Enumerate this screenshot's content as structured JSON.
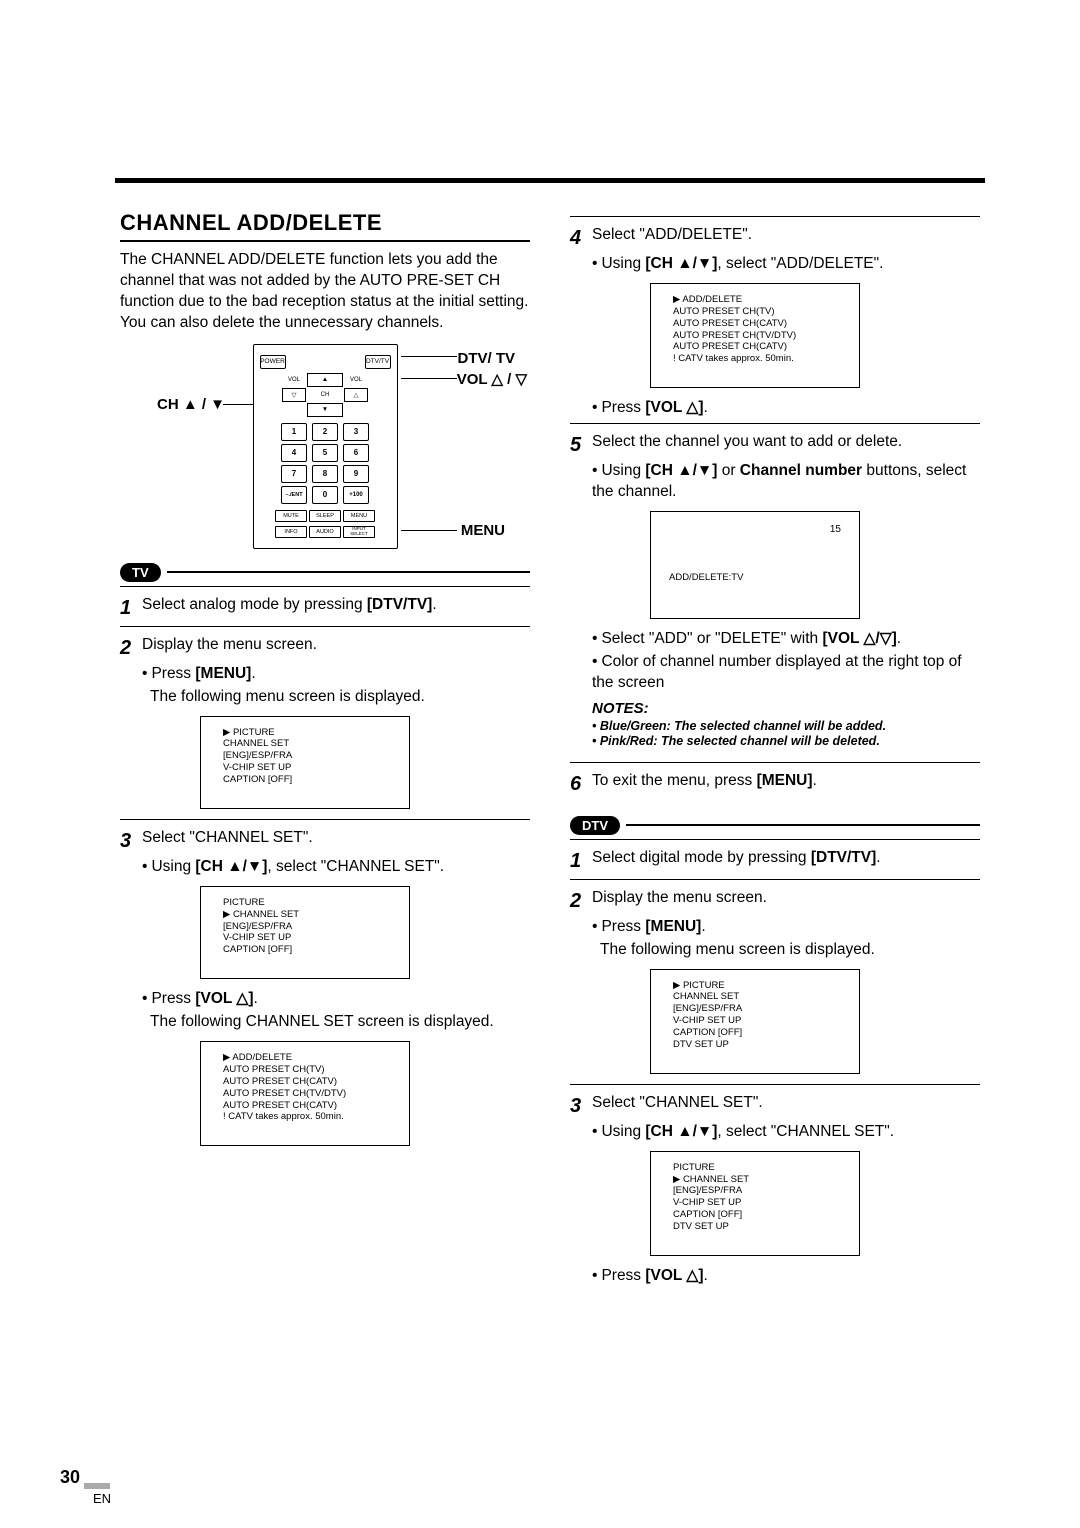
{
  "title": "CHANNEL ADD/DELETE",
  "intro": "The CHANNEL ADD/DELETE function lets you add the channel that was not added by the AUTO PRE-SET CH function due to the bad reception status at the initial setting. You can also delete the unnecessary channels.",
  "callouts": {
    "dtvtv": "DTV/ TV",
    "vol": "VOL △ / ▽",
    "ch": "CH ▲ / ▼",
    "menu": "MENU"
  },
  "remote": {
    "power": "POWER",
    "dtvtv": "DTV/TV",
    "vol": "VOL",
    "ch": "CH",
    "numpad": [
      "1",
      "2",
      "3",
      "4",
      "5",
      "6",
      "7",
      "8",
      "9",
      "–./ENT",
      "0",
      "+100"
    ],
    "bottom_row1": [
      "MUTE",
      "SLEEP",
      "MENU"
    ],
    "bottom_row2": [
      "INFO",
      "AUDIO",
      "INPUT SELECT"
    ]
  },
  "tv_badge": "TV",
  "dtv_badge": "DTV",
  "left_steps": {
    "s1": "Select analog mode by pressing ",
    "s1_b": "[DTV/TV]",
    "s1_tail": ".",
    "s2": "Display the menu screen.",
    "s2_sub_a_pre": "Press ",
    "s2_sub_a_b": "[MENU]",
    "s2_sub_a_tail": ".",
    "s2_sub_b": "The following menu screen is displayed.",
    "s3": "Select \"CHANNEL SET\".",
    "s3_sub_a_pre": "Using ",
    "s3_sub_a_b": "[CH ▲/▼]",
    "s3_sub_a_tail": ", select \"CHANNEL SET\".",
    "s3_sub_b_pre": "Press ",
    "s3_sub_b_b": "[VOL △]",
    "s3_sub_b_tail": ".",
    "s3_sub_c": "The following CHANNEL SET screen is displayed."
  },
  "right_steps": {
    "s4": "Select \"ADD/DELETE\".",
    "s4_sub_a_pre": "Using ",
    "s4_sub_a_b": "[CH ▲/▼]",
    "s4_sub_a_tail": ", select \"ADD/DELETE\".",
    "s4_sub_b_pre": "Press ",
    "s4_sub_b_b": "[VOL △]",
    "s4_sub_b_tail": ".",
    "s5": "Select the channel you want to add or delete.",
    "s5_sub_a_pre": "Using ",
    "s5_sub_a_b1": "[CH ▲/▼]",
    "s5_sub_a_mid": " or ",
    "s5_sub_a_b2": "Channel number",
    "s5_sub_a_tail": " buttons, select the channel.",
    "s5_sub_b_pre": "Select \"ADD\" or \"DELETE\" with ",
    "s5_sub_b_b": "[VOL △/▽]",
    "s5_sub_b_tail": ".",
    "s5_sub_c": "Color of channel number displayed at the right top of the screen",
    "s6_pre": "To exit the menu, press ",
    "s6_b": "[MENU]",
    "s6_tail": ".",
    "d1_pre": "Select digital mode by pressing ",
    "d1_b": "[DTV/TV]",
    "d1_tail": ".",
    "d2": "Display the menu screen.",
    "d2_sub_a_pre": "Press ",
    "d2_sub_a_b": "[MENU]",
    "d2_sub_a_tail": ".",
    "d2_sub_b": "The following menu screen is displayed.",
    "d3": "Select \"CHANNEL SET\".",
    "d3_sub_a_pre": "Using ",
    "d3_sub_a_b": "[CH ▲/▼]",
    "d3_sub_a_tail": ", select \"CHANNEL SET\".",
    "d3_sub_b_pre": "Press ",
    "d3_sub_b_b": "[VOL △]",
    "d3_sub_b_tail": "."
  },
  "notes": {
    "heading": "NOTES:",
    "n1": "• Blue/Green: The selected channel will be added.",
    "n2": "• Pink/Red: The selected channel will be deleted."
  },
  "osd1_lines": [
    "▶ PICTURE",
    "   CHANNEL SET",
    "   [ENG]/ESP/FRA",
    "   V-CHIP SET UP",
    "   CAPTION [OFF]"
  ],
  "osd2_lines": [
    "   PICTURE",
    "▶ CHANNEL SET",
    "   [ENG]/ESP/FRA",
    "   V-CHIP SET UP",
    "   CAPTION [OFF]"
  ],
  "osd3_lines": [
    "▶ ADD/DELETE",
    "   AUTO PRESET CH(TV)",
    "   AUTO PRESET CH(CATV)",
    "   AUTO PRESET CH(TV/DTV)",
    "   AUTO PRESET CH(CATV)",
    "   ! CATV takes approx. 50min."
  ],
  "osd4_lines": [
    "▶ ADD/DELETE",
    "   AUTO PRESET CH(TV)",
    "   AUTO PRESET CH(CATV)",
    "   AUTO PRESET CH(TV/DTV)",
    "   AUTO PRESET CH(CATV)",
    "   ! CATV takes approx. 50min."
  ],
  "osd5_num": "15",
  "osd5_label": "ADD/DELETE:TV",
  "osd6_lines": [
    "▶ PICTURE",
    "   CHANNEL SET",
    "   [ENG]/ESP/FRA",
    "   V-CHIP SET UP",
    "   CAPTION [OFF]",
    "   DTV SET UP"
  ],
  "osd7_lines": [
    "   PICTURE",
    "▶ CHANNEL SET",
    "   [ENG]/ESP/FRA",
    "   V-CHIP SET UP",
    "   CAPTION [OFF]",
    "   DTV SET UP"
  ],
  "page_number": "30",
  "page_sub": "EN"
}
